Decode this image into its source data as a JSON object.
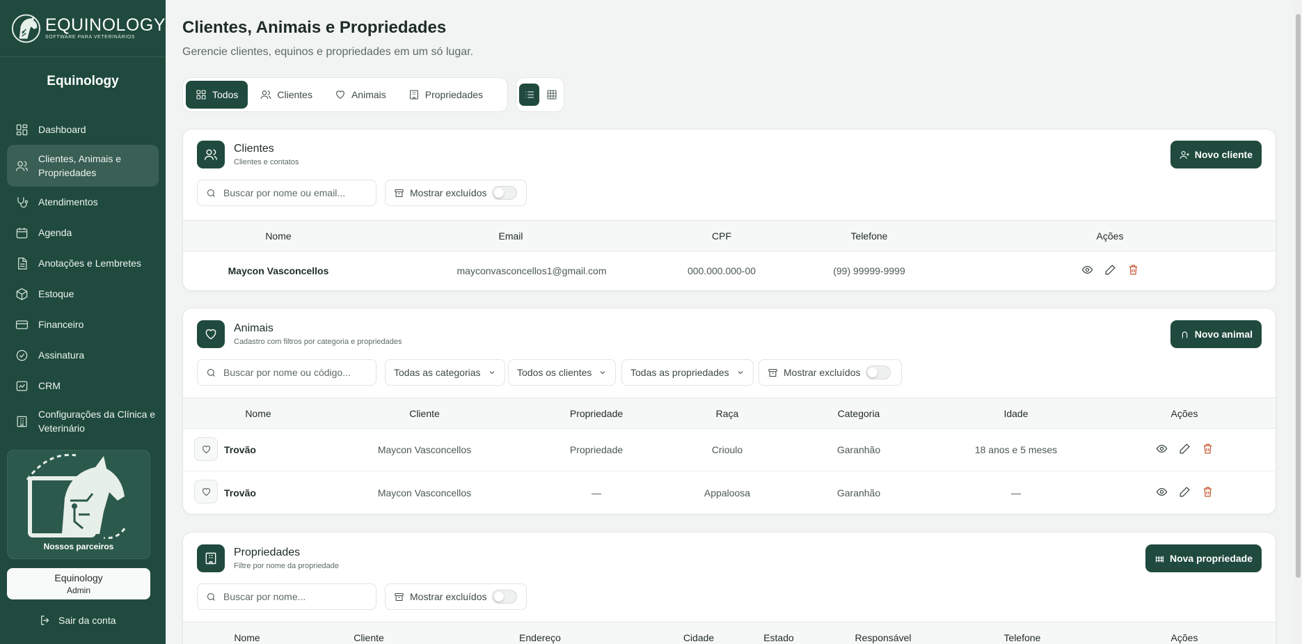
{
  "brand": {
    "logo_title": "EQUINOLOGY",
    "logo_subtitle": "SOFTWARE PARA VETERINÁRIOS",
    "sidebar_name": "Equinology"
  },
  "sidebar": {
    "items": [
      {
        "label": "Dashboard",
        "icon": "dashboard-icon"
      },
      {
        "label": "Clientes, Animais e Propriedades",
        "icon": "users-icon"
      },
      {
        "label": "Atendimentos",
        "icon": "stethoscope-icon"
      },
      {
        "label": "Agenda",
        "icon": "calendar-icon"
      },
      {
        "label": "Anotações e Lembretes",
        "icon": "notes-icon"
      },
      {
        "label": "Estoque",
        "icon": "package-icon"
      },
      {
        "label": "Financeiro",
        "icon": "credit-card-icon"
      },
      {
        "label": "Assinatura",
        "icon": "check-circle-icon"
      },
      {
        "label": "CRM",
        "icon": "crm-icon"
      },
      {
        "label": "Configurações da Clínica e Veterinário",
        "icon": "building-icon"
      }
    ],
    "partners_label": "Nossos parceiros",
    "user_name": "Equinology",
    "user_role": "Admin",
    "logout_label": "Sair da conta"
  },
  "header": {
    "title": "Clientes, Animais e Propriedades",
    "subtitle": "Gerencie clientes, equinos e propriedades em um só lugar."
  },
  "tabs": [
    {
      "label": "Todos",
      "active": true
    },
    {
      "label": "Clientes",
      "active": false
    },
    {
      "label": "Animais",
      "active": false
    },
    {
      "label": "Propriedades",
      "active": false
    }
  ],
  "clientes": {
    "title": "Clientes",
    "subtitle": "Clientes e contatos",
    "new_button": "Novo cliente",
    "search_placeholder": "Buscar por nome ou email...",
    "show_deleted": "Mostrar excluídos",
    "columns": [
      "Nome",
      "Email",
      "CPF",
      "Telefone",
      "Ações"
    ],
    "rows": [
      {
        "nome": "Maycon Vasconcellos",
        "email": "mayconvasconcellos1@gmail.com",
        "cpf": "000.000.000-00",
        "telefone": "(99) 99999-9999"
      }
    ]
  },
  "animais": {
    "title": "Animais",
    "subtitle": "Cadastro com filtros por categoria e propriedades",
    "new_button": "Novo animal",
    "search_placeholder": "Buscar por nome ou código...",
    "filter_categoria": "Todas as categorias",
    "filter_cliente": "Todos os clientes",
    "filter_propriedade": "Todas as propriedades",
    "show_deleted": "Mostrar excluídos",
    "columns": [
      "Nome",
      "Cliente",
      "Propriedade",
      "Raça",
      "Categoria",
      "Idade",
      "Ações"
    ],
    "rows": [
      {
        "nome": "Trovão",
        "cliente": "Maycon Vasconcellos",
        "propriedade": "Propriedade",
        "raca": "Crioulo",
        "categoria": "Garanhão",
        "idade": "18 anos e 5 meses"
      },
      {
        "nome": "Trovão",
        "cliente": "Maycon Vasconcellos",
        "propriedade": "—",
        "raca": "Appaloosa",
        "categoria": "Garanhão",
        "idade": "—"
      }
    ]
  },
  "propriedades": {
    "title": "Propriedades",
    "subtitle": "Filtre por nome da propriedade",
    "new_button": "Nova propriedade",
    "search_placeholder": "Buscar por nome...",
    "show_deleted": "Mostrar excluídos",
    "columns": [
      "Nome",
      "Cliente",
      "Endereço",
      "Cidade",
      "Estado",
      "Responsável",
      "Telefone",
      "Ações"
    ]
  },
  "colors": {
    "primary": "#1f4a3d",
    "sidebar_bg": "#1f4a3d",
    "delete": "#c2552d"
  }
}
